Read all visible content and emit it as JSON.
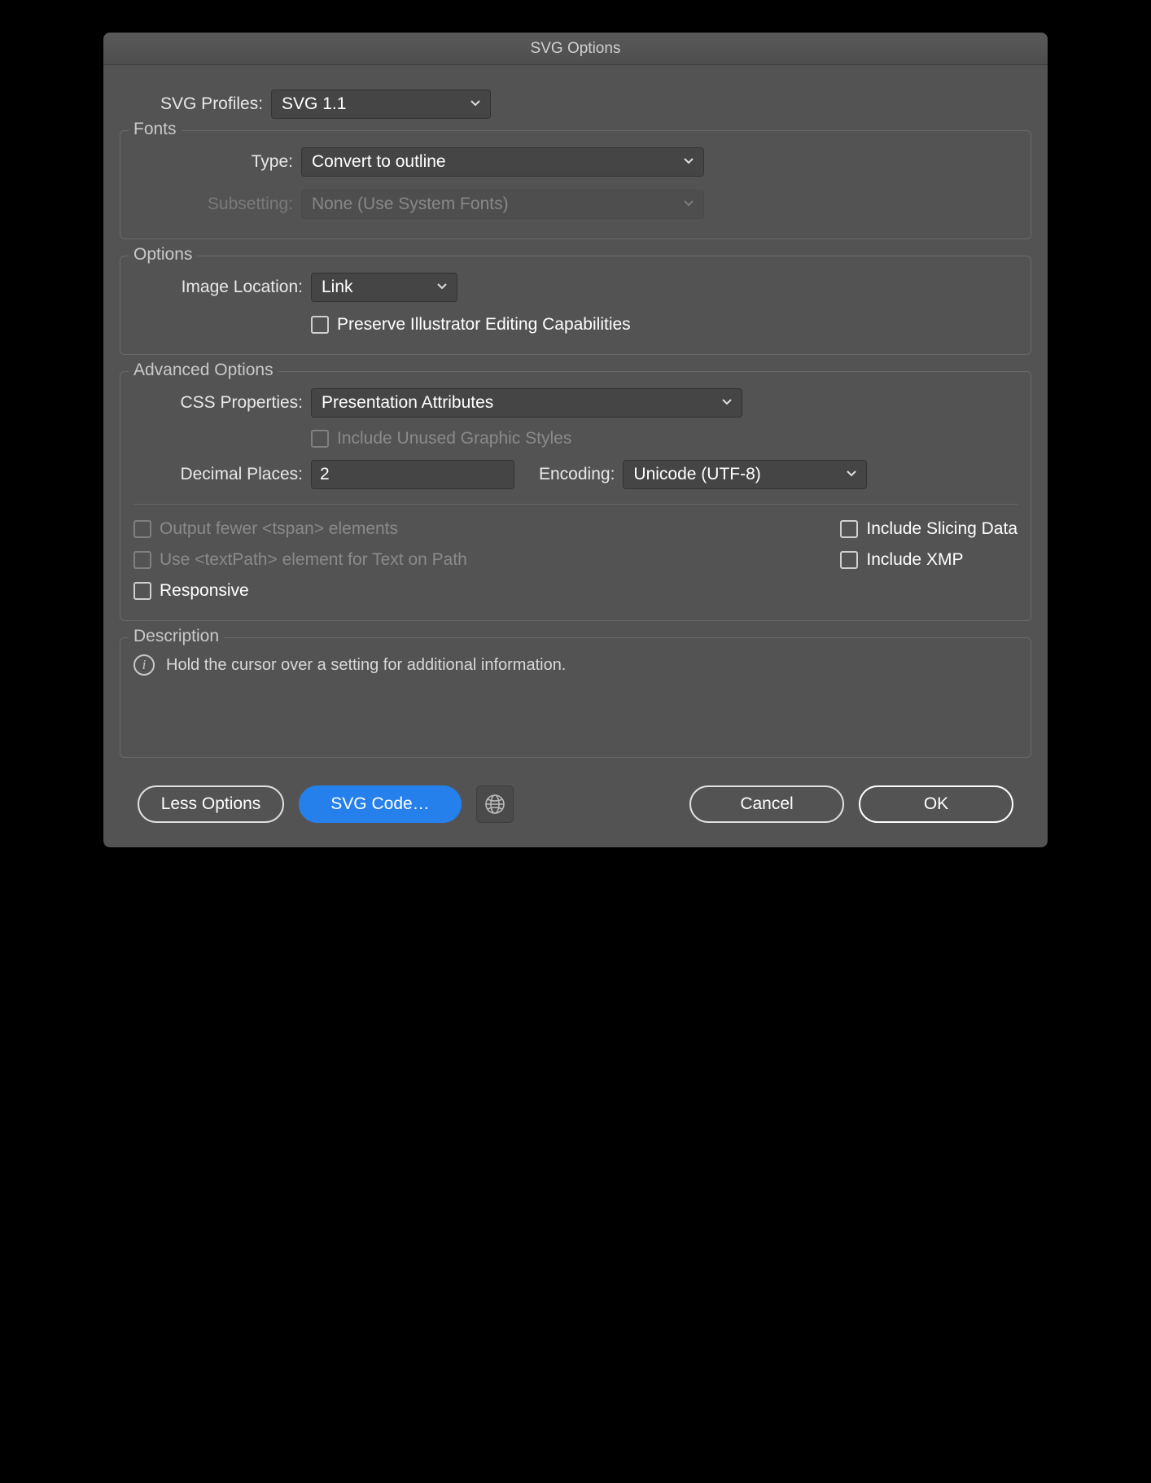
{
  "title": "SVG Options",
  "svg_profiles": {
    "label": "SVG Profiles:",
    "value": "SVG 1.1"
  },
  "fonts": {
    "legend": "Fonts",
    "type": {
      "label": "Type:",
      "value": "Convert to outline"
    },
    "subsetting": {
      "label": "Subsetting:",
      "value": "None (Use System Fonts)"
    }
  },
  "options": {
    "legend": "Options",
    "image_location": {
      "label": "Image Location:",
      "value": "Link"
    },
    "preserve_editing": {
      "label": "Preserve Illustrator Editing Capabilities",
      "checked": false
    }
  },
  "advanced": {
    "legend": "Advanced Options",
    "css_properties": {
      "label": "CSS Properties:",
      "value": "Presentation Attributes"
    },
    "include_unused": {
      "label": "Include Unused Graphic Styles",
      "checked": false
    },
    "decimal_places": {
      "label": "Decimal Places:",
      "value": "2"
    },
    "encoding": {
      "label": "Encoding:",
      "value": "Unicode (UTF-8)"
    },
    "output_fewer_tspan": {
      "label": "Output fewer <tspan> elements",
      "checked": false
    },
    "use_textpath": {
      "label": "Use <textPath> element for Text on Path",
      "checked": false
    },
    "include_slicing": {
      "label": "Include Slicing Data",
      "checked": false
    },
    "include_xmp": {
      "label": "Include XMP",
      "checked": false
    },
    "responsive": {
      "label": "Responsive",
      "checked": false
    }
  },
  "description": {
    "legend": "Description",
    "text": "Hold the cursor over a setting for additional information."
  },
  "buttons": {
    "less_options": "Less Options",
    "svg_code": "SVG Code…",
    "cancel": "Cancel",
    "ok": "OK"
  }
}
